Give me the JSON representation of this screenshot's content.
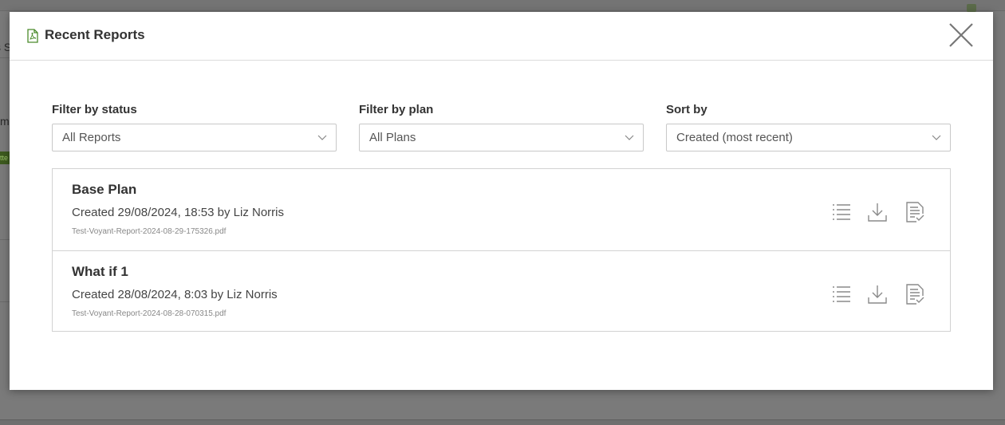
{
  "background": {
    "fragment_1": "s S",
    "fragment_2": "m",
    "badge": "tte"
  },
  "modal": {
    "title": "Recent Reports",
    "header_icon": "pdf-file-icon",
    "close_icon": "close-icon"
  },
  "filters": {
    "status": {
      "label": "Filter by status",
      "value": "All Reports"
    },
    "plan": {
      "label": "Filter by plan",
      "value": "All Plans"
    },
    "sort": {
      "label": "Sort by",
      "value": "Created (most recent)"
    }
  },
  "reports": [
    {
      "name": "Base Plan",
      "meta": "Created 29/08/2024, 18:53 by Liz Norris",
      "file": "Test-Voyant-Report-2024-08-29-175326.pdf"
    },
    {
      "name": "What if 1",
      "meta": "Created 28/08/2024, 8:03 by Liz Norris",
      "file": "Test-Voyant-Report-2024-08-28-070315.pdf"
    }
  ],
  "actions": {
    "icons": [
      "list-icon",
      "download-icon",
      "report-check-icon"
    ]
  },
  "colors": {
    "accent": "#4a8a2a",
    "icon_gray": "#8a8a8a",
    "overlay": "#7a7a7a"
  }
}
